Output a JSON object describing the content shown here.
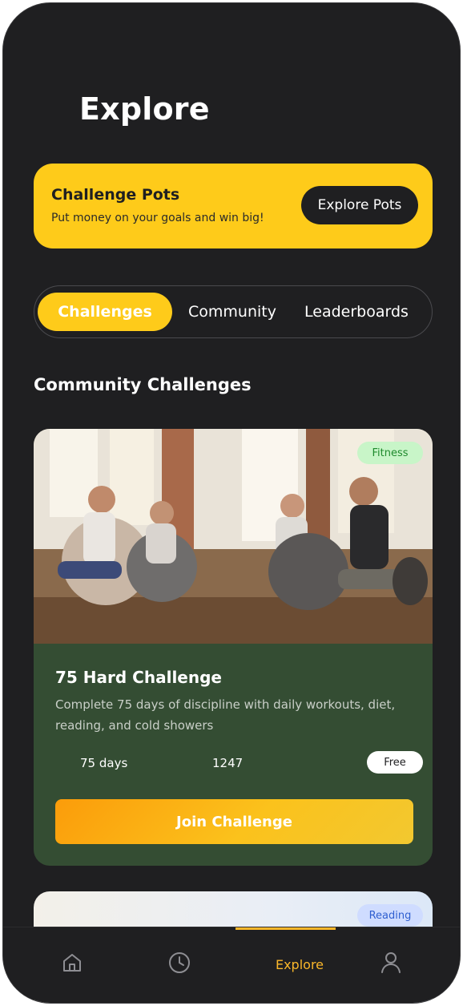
{
  "header": {
    "title": "Explore"
  },
  "pots_banner": {
    "title": "Challenge Pots",
    "subtitle": "Put money on your goals and win big!",
    "button_label": "Explore Pots"
  },
  "tabs": [
    {
      "label": "Challenges",
      "active": true
    },
    {
      "label": "Community",
      "active": false
    },
    {
      "label": "Leaderboards",
      "active": false
    }
  ],
  "section": {
    "title": "Community Challenges"
  },
  "challenges": [
    {
      "category": "Fitness",
      "title": "75 Hard Challenge",
      "description": "Complete 75 days of discipline with daily workouts, diet, reading, and cold showers",
      "duration": "75 days",
      "participants": "1247",
      "price": "Free",
      "button_label": "Join Challenge"
    },
    {
      "category": "Reading"
    }
  ],
  "nav": {
    "items": [
      {
        "icon": "home-icon",
        "label": ""
      },
      {
        "icon": "clock-icon",
        "label": ""
      },
      {
        "icon": "",
        "label": "Explore",
        "active": true
      },
      {
        "icon": "user-icon",
        "label": ""
      }
    ]
  },
  "colors": {
    "background": "#1f1f21",
    "accent": "#fecb1a",
    "card": "#344d33",
    "nav_active": "#fbb72a"
  }
}
